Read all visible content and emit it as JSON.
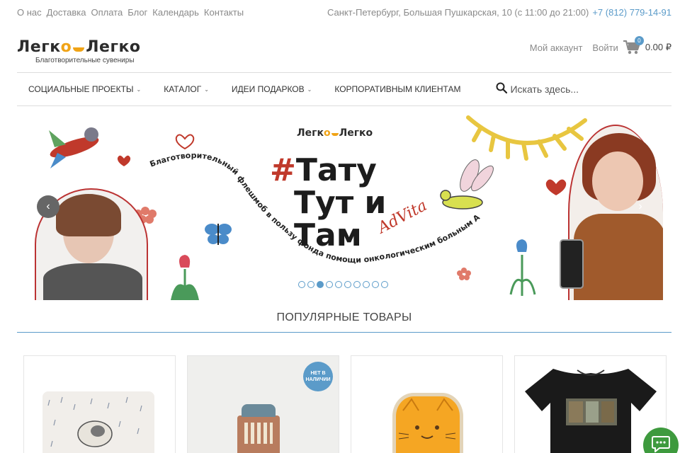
{
  "topbar": {
    "links": [
      "О нас",
      "Доставка",
      "Оплата",
      "Блог",
      "Календарь",
      "Контакты"
    ],
    "address": "Санкт-Петербург, Большая Пушкарская, 10 (с 11:00 до 21:00)",
    "phone": "+7 (812) 779-14-91"
  },
  "header": {
    "logo_left": "Легк",
    "logo_o": "о",
    "logo_right": "Легко",
    "tagline": "Благотворительные сувениры",
    "account": "Мой аккаунт",
    "login": "Войти",
    "cart_count": "0",
    "cart_total": "0.00 ₽"
  },
  "nav": {
    "items": [
      {
        "label": "СОЦИАЛЬНЫЕ ПРОЕКТЫ",
        "has_dropdown": true
      },
      {
        "label": "КАТАЛОГ",
        "has_dropdown": true
      },
      {
        "label": "ИДЕИ ПОДАРКОВ",
        "has_dropdown": true
      },
      {
        "label": "КОРПОРАТИВНЫМ КЛИЕНТАМ",
        "has_dropdown": false
      }
    ],
    "search_placeholder": "Искать здесь..."
  },
  "banner": {
    "logo_left": "Легк",
    "logo_o": "о",
    "logo_right": "Легко",
    "title_hash": "#",
    "title_line1": "Тату",
    "title_line2": "Тут и",
    "title_line3": "Там",
    "signature": "AdVita",
    "curve_text": "Благотворительный флешмоб в пользу фонда помощи онкологическим больным AdVita",
    "slide_count": 10,
    "active_slide": 3
  },
  "popular": {
    "title": "ПОПУЛЯРНЫЕ ТОВАРЫ",
    "out_of_stock_line1": "НЕТ В",
    "out_of_stock_line2": "НАЛИЧИИ"
  },
  "colors": {
    "accent": "#5b9bc9",
    "logo_orange": "#f0a316",
    "banner_red": "#c0392b",
    "chat_green": "#3e9a3e"
  }
}
